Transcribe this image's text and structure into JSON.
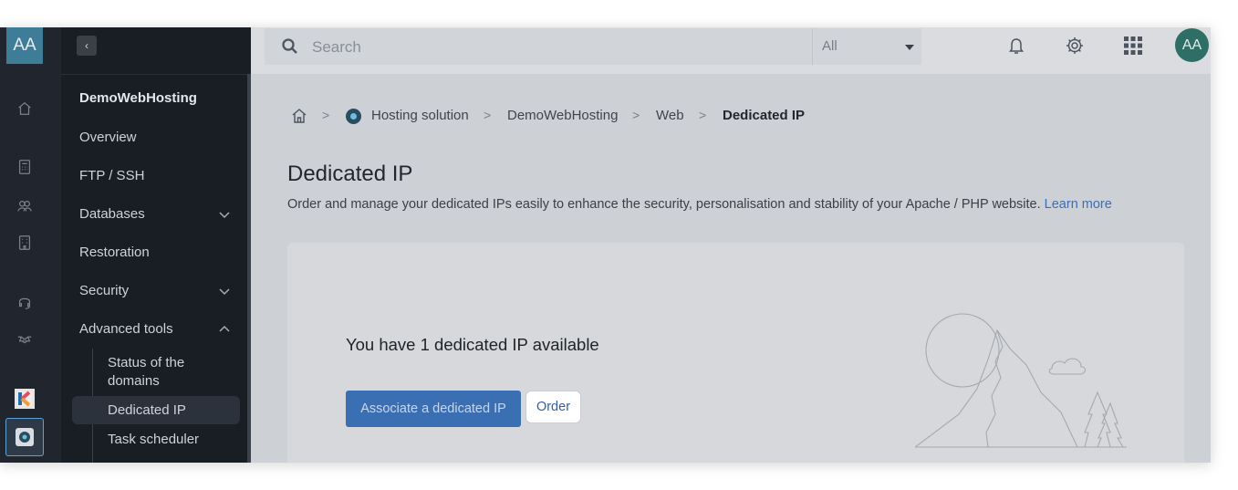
{
  "rail": {
    "avatar_initials": "AA"
  },
  "sidebar": {
    "collapse_label": "‹",
    "title": "DemoWebHosting",
    "items": [
      {
        "label": "Overview"
      },
      {
        "label": "FTP / SSH"
      },
      {
        "label": "Databases"
      },
      {
        "label": "Restoration"
      },
      {
        "label": "Security"
      },
      {
        "label": "Advanced tools"
      }
    ],
    "subitems": [
      {
        "label": "Status of the domains"
      },
      {
        "label": "Dedicated IP"
      },
      {
        "label": "Task scheduler"
      }
    ]
  },
  "header": {
    "search_placeholder": "Search",
    "filter_value": "All",
    "avatar_initials": "AA"
  },
  "breadcrumb": {
    "items": [
      "Hosting solution",
      "DemoWebHosting",
      "Web",
      "Dedicated IP"
    ],
    "separator": ">"
  },
  "page": {
    "title": "Dedicated IP",
    "description": "Order and manage your dedicated IPs easily to enhance the security, personalisation and stability of your Apache / PHP website.",
    "learn_more": "Learn more"
  },
  "card": {
    "heading": "You have 1 dedicated IP available",
    "primary_button": "Associate a dedicated IP",
    "secondary_button": "Order"
  },
  "colors": {
    "accent": "#3b6fb4",
    "rail_bg": "#20252e",
    "sidebar_bg": "#191d24",
    "avatar": "#2d6e66"
  }
}
